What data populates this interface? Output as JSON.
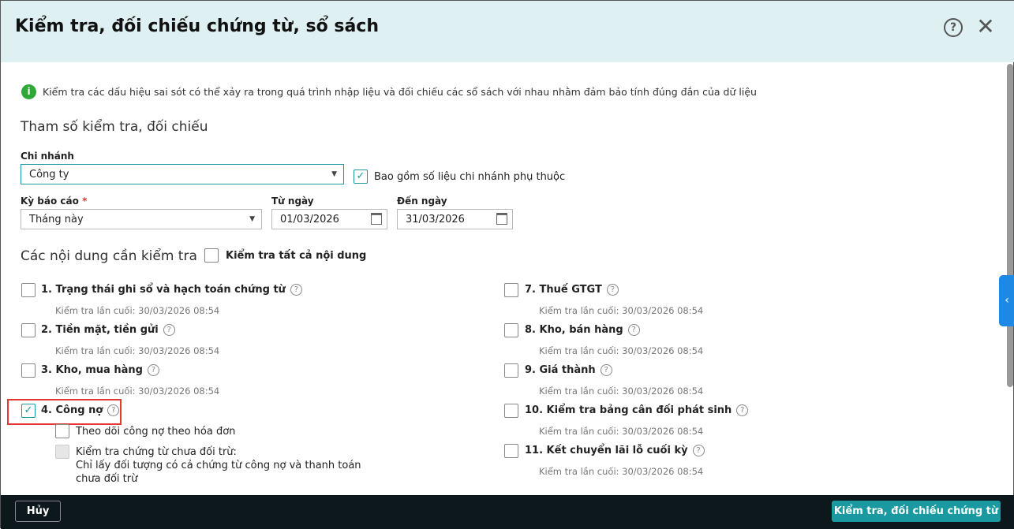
{
  "dialog": {
    "title": "Kiểm tra, đối chiếu chứng từ, sổ sách",
    "help_icon": "?",
    "close_icon": "✕"
  },
  "info": "Kiểm tra các dấu hiệu sai sót có thể xảy ra trong quá trình nhập liệu và đối chiếu các sổ sách với nhau nhằm đảm bảo tính đúng đắn của dữ liệu",
  "params": {
    "heading": "Tham số kiểm tra, đối chiếu",
    "branch_label": "Chi nhánh",
    "branch_value": "Công ty",
    "include_sub": "Bao gồm số liệu chi nhánh phụ thuộc",
    "include_sub_checked": true,
    "period_label": "Kỳ báo cáo",
    "required_mark": "*",
    "period_value": "Tháng này",
    "from_label": "Từ ngày",
    "from_value": "01/03/2026",
    "to_label": "Đến ngày",
    "to_value": "31/03/2026"
  },
  "content": {
    "heading": "Các nội dung cần kiểm tra",
    "check_all": "Kiểm tra tất cả nội dung",
    "left": [
      {
        "label": "1. Trạng thái ghi sổ và hạch toán chứng từ",
        "last": "Kiểm tra lần cuối: 30/03/2026 08:54",
        "checked": false
      },
      {
        "label": "2. Tiền mặt, tiền gửi",
        "last": "Kiểm tra lần cuối: 30/03/2026 08:54",
        "checked": false
      },
      {
        "label": "3. Kho, mua hàng",
        "last": "Kiểm tra lần cuối: 30/03/2026 08:54",
        "checked": false
      },
      {
        "label": "4. Công nợ",
        "checked": true
      }
    ],
    "sub_options": [
      "Theo dõi công nợ theo hóa đơn",
      "Kiểm tra chứng từ chưa đối trừ:",
      "Chỉ lấy đối tượng có cả chứng từ công nợ và thanh toán chưa đối trừ"
    ],
    "right": [
      {
        "label": "7. Thuế GTGT",
        "last": "Kiểm tra lần cuối: 30/03/2026 08:54"
      },
      {
        "label": "8. Kho, bán hàng",
        "last": "Kiểm tra lần cuối: 30/03/2026 08:54"
      },
      {
        "label": "9. Giá thành",
        "last": "Kiểm tra lần cuối: 30/03/2026 08:54"
      },
      {
        "label": "10. Kiểm tra bảng cân đối phát sinh",
        "last": "Kiểm tra lần cuối: 30/03/2026 08:54"
      },
      {
        "label": "11. Kết chuyển lãi lỗ cuối kỳ",
        "last": "Kiểm tra lần cuối: 30/03/2026 08:54"
      }
    ]
  },
  "footer": {
    "cancel": "Hủy",
    "submit": "Kiểm tra, đối chiếu chứng từ"
  }
}
